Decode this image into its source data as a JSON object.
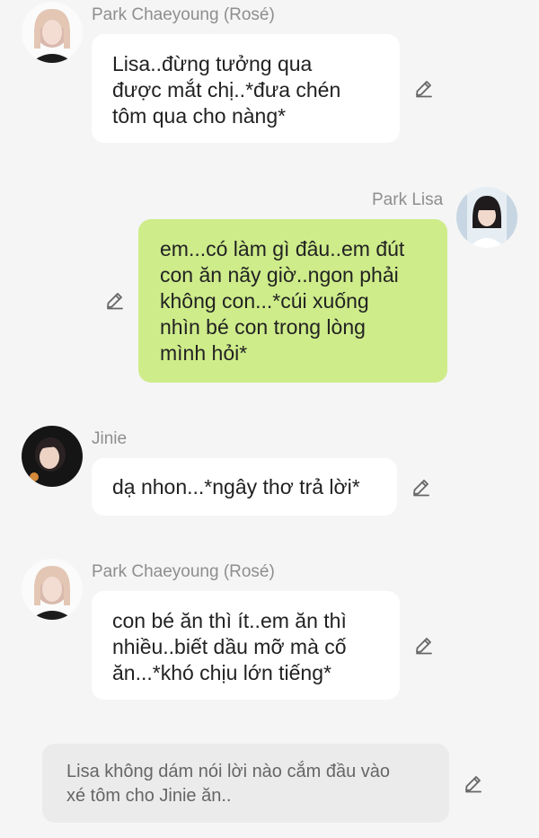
{
  "messages": [
    {
      "sender": "Park Chaeyoung (Rosé)",
      "lines": [
        "Lisa..đừng tưởng qua",
        "được mắt chị..*đưa chén",
        "tôm qua cho nàng*"
      ]
    },
    {
      "sender": "Park Lisa",
      "lines": [
        "em...có làm gì đâu..em đút",
        "con ăn nãy giờ..ngon phải",
        "không con...*cúi xuống",
        "nhìn bé con trong lòng",
        "mình hỏi*"
      ]
    },
    {
      "sender": "Jinie",
      "lines": [
        "dạ nhon...*ngây thơ trả lời*"
      ]
    },
    {
      "sender": "Park Chaeyoung (Rosé)",
      "lines": [
        "con bé ăn thì ít..em ăn thì",
        "nhiều..biết dầu mỡ mà cố",
        "ăn...*khó chịu lớn tiếng*"
      ]
    }
  ],
  "narration": {
    "lines": [
      "Lisa không dám nói lời nào cắm đầu vào",
      "xé tôm cho Jinie ăn.."
    ]
  },
  "icons": {
    "avatar": "avatar",
    "edit": "pencil-edit-icon"
  },
  "colors": {
    "background": "#f5f5f5",
    "bubble_incoming": "#ffffff",
    "bubble_outgoing": "#ceec8a",
    "bubble_narration": "#ebebeb",
    "name_text": "#8e8e8e"
  }
}
